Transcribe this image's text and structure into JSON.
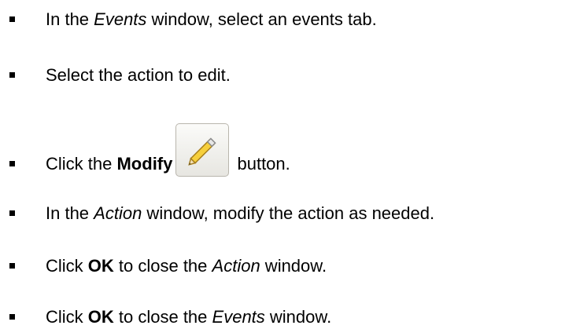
{
  "steps": [
    {
      "pre": "In the ",
      "em": "Events",
      "post": " window, select an events tab."
    },
    {
      "text": "Select the action to edit."
    },
    {
      "pre": "Click the ",
      "strong": "Modify",
      "button_icon": "pencil-icon",
      "post": " button."
    },
    {
      "pre": "In the ",
      "em": "Action",
      "post": " window, modify the action as needed."
    },
    {
      "pre": "Click ",
      "strong": "OK",
      "mid": " to close the ",
      "em": "Action",
      "post": " window."
    },
    {
      "pre": "Click ",
      "strong": "OK",
      "mid": " to close the ",
      "em": "Events",
      "post": " window."
    }
  ]
}
